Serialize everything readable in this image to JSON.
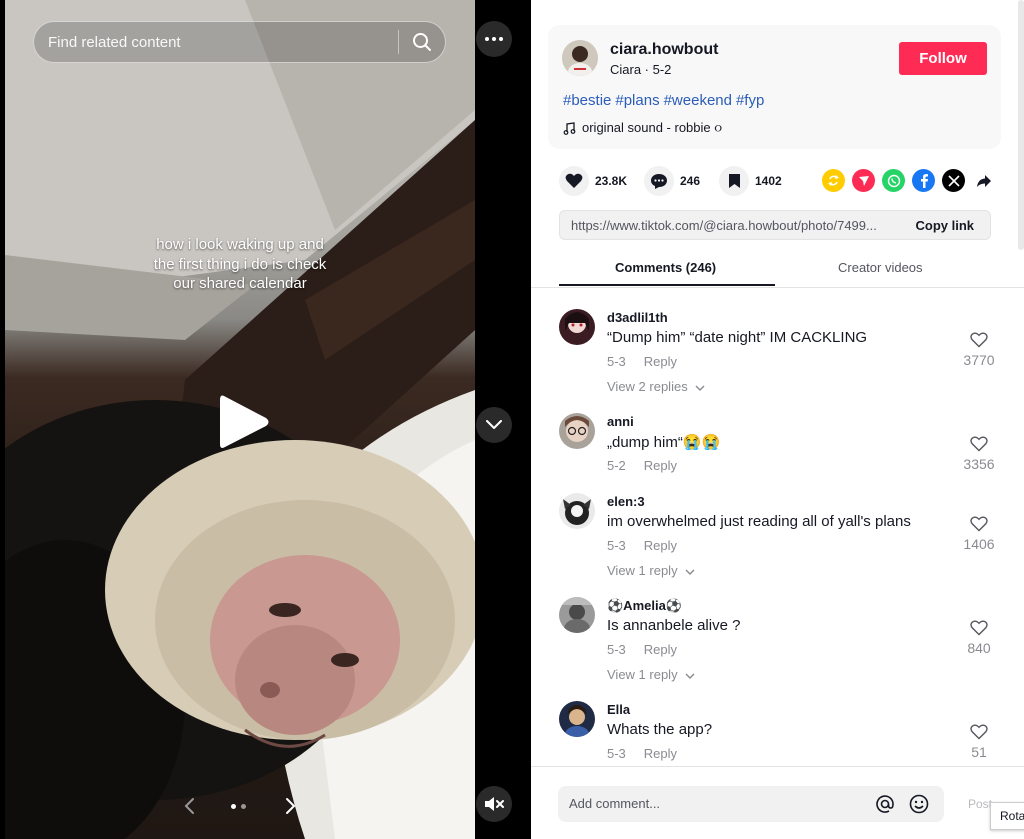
{
  "media": {
    "search_placeholder": "Find related content",
    "caption_lines": [
      "how i look waking up and",
      "the first thing i do is check",
      "our shared calendar"
    ],
    "carousel": {
      "total": 2,
      "active": 1
    }
  },
  "author": {
    "username": "ciara.howbout",
    "subline": "Ciara · 5-2",
    "follow_label": "Follow",
    "hashtags": [
      "#bestie",
      "#plans",
      "#weekend",
      "#fyp"
    ],
    "sound": "original sound - robbie ૦"
  },
  "stats": {
    "likes": "23.8K",
    "comments": "246",
    "saves": "1402"
  },
  "share_icons": [
    "repost-icon",
    "send-icon",
    "whatsapp-icon",
    "facebook-icon",
    "x-icon",
    "share-arrow-icon"
  ],
  "link": {
    "url": "https://www.tiktok.com/@ciara.howbout/photo/7499...",
    "copy_label": "Copy link"
  },
  "tabs": {
    "comments": "Comments (246)",
    "creator": "Creator videos"
  },
  "comments": [
    {
      "name": "d3adlil1th",
      "text": "“Dump him” “date night” IM CACKLING",
      "date": "5-3",
      "reply": "Reply",
      "likes": "3770",
      "replies": "View 2 replies"
    },
    {
      "name": "anni",
      "text": "„dump him“😭😭",
      "date": "5-2",
      "reply": "Reply",
      "likes": "3356",
      "replies": ""
    },
    {
      "name": "elen:3",
      "text": "im overwhelmed just reading all of yall's plans",
      "date": "5-3",
      "reply": "Reply",
      "likes": "1406",
      "replies": "View 1 reply"
    },
    {
      "name": "⚽Amelia⚽",
      "text": "Is annanbele alive ?",
      "date": "5-3",
      "reply": "Reply",
      "likes": "840",
      "replies": "View 1 reply"
    },
    {
      "name": "Ella",
      "text": "Whats the app?",
      "date": "5-3",
      "reply": "Reply",
      "likes": "51",
      "replies": ""
    }
  ],
  "composer": {
    "placeholder": "Add comment...",
    "post_label": "Post"
  },
  "tooltip": "Rota",
  "colors": {
    "accent": "#fe2c55",
    "hashtag": "#2b5db9",
    "muted": "#8a8b91"
  }
}
